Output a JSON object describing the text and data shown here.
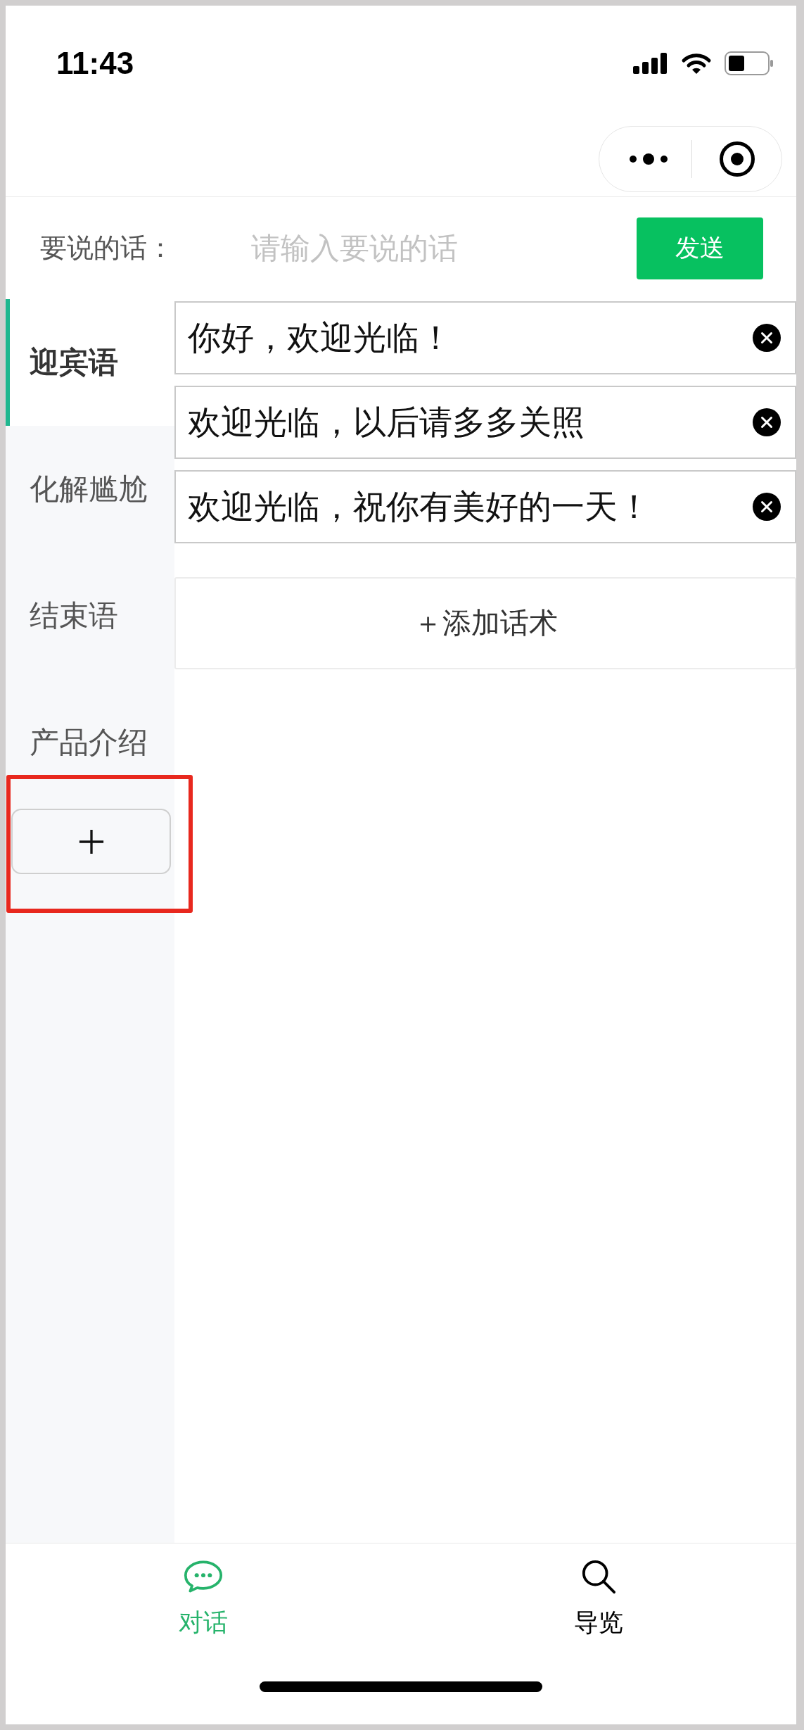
{
  "status_bar": {
    "time": "11:43"
  },
  "message_bar": {
    "label": "要说的话：",
    "placeholder": "请输入要说的话",
    "send_button": "发送"
  },
  "categories": [
    {
      "label": "迎宾语",
      "selected": true
    },
    {
      "label": "化解尴尬",
      "selected": false
    },
    {
      "label": "结束语",
      "selected": false
    },
    {
      "label": "产品介绍",
      "selected": false
    }
  ],
  "category_add_button": {
    "highlighted": true
  },
  "phrases": [
    {
      "text": "你好，欢迎光临！"
    },
    {
      "text": "欢迎光临，以后请多多关照"
    },
    {
      "text": "欢迎光临，祝你有美好的一天！"
    }
  ],
  "add_phrase_button": "＋添加话术",
  "tab_bar": [
    {
      "label": "对话",
      "kind": "chat",
      "selected": true
    },
    {
      "label": "导览",
      "kind": "search",
      "selected": false
    }
  ]
}
